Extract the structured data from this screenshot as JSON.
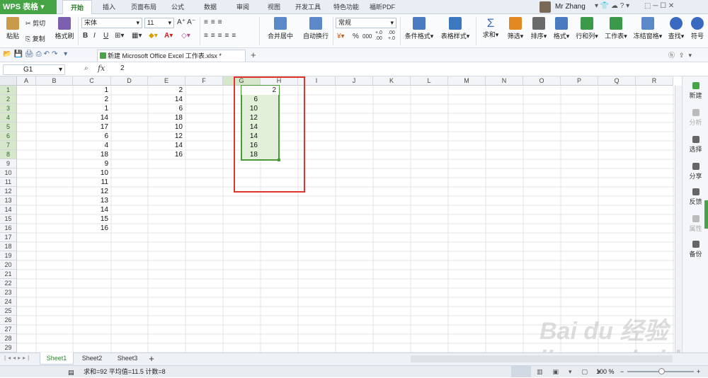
{
  "app": {
    "name": "WPS 表格"
  },
  "menu_tabs": [
    "开始",
    "插入",
    "页面布局",
    "公式",
    "数据",
    "审阅",
    "视图",
    "开发工具",
    "特色功能",
    "福昕PDF"
  ],
  "user": {
    "name": "Mr Zhang"
  },
  "ribbon": {
    "paste": "粘贴",
    "cut": "剪切",
    "copy": "复制",
    "format_painter": "格式刷",
    "font_name": "宋体",
    "font_size": "11",
    "merge_center": "合并居中",
    "wrap_text": "自动换行",
    "number_format": "常规",
    "conditional_format": "条件格式",
    "table_style": "表格样式",
    "sum": "求和",
    "filter": "筛选",
    "sort": "排序",
    "format": "格式",
    "rows_cols": "行和列",
    "worksheet": "工作表",
    "freeze": "冻结窗格",
    "find": "查找",
    "symbol": "符号",
    "percent": "%",
    "comma": "000",
    "dec_inc": "+.0 .00",
    "dec_dec": ".00 +.0"
  },
  "document": {
    "tab_title": "新建 Microsoft Office Excel 工作表.xlsx *"
  },
  "formula_bar": {
    "name_box": "G1",
    "fx": "fx",
    "value": "2"
  },
  "grid": {
    "columns": [
      "A",
      "B",
      "C",
      "D",
      "E",
      "F",
      "G",
      "H",
      "I",
      "J",
      "K",
      "L",
      "M",
      "N",
      "O",
      "P",
      "Q",
      "R"
    ],
    "rows": [
      "1",
      "2",
      "3",
      "4",
      "5",
      "6",
      "7",
      "8",
      "9",
      "10",
      "11",
      "12",
      "13",
      "14",
      "15",
      "16",
      "17",
      "18",
      "19",
      "20",
      "21",
      "22",
      "23",
      "24",
      "25",
      "26",
      "27",
      "28",
      "29"
    ],
    "col_c": [
      "1",
      "2",
      "1",
      "14",
      "17",
      "6",
      "4",
      "18",
      "9",
      "10",
      "11",
      "12",
      "13",
      "14",
      "15",
      "16"
    ],
    "col_e": [
      "2",
      "14",
      "6",
      "18",
      "10",
      "12",
      "14",
      "16"
    ],
    "col_g": [
      "2",
      "6",
      "10",
      "12",
      "14",
      "14",
      "16",
      "18"
    ]
  },
  "side_panel": [
    "新建",
    "分析",
    "选择",
    "分享",
    "反馈",
    "属性",
    "备份"
  ],
  "sheets": [
    "Sheet1",
    "Sheet2",
    "Sheet3"
  ],
  "status_bar": {
    "summary": "求和=92  平均值=11.5  计数=8",
    "zoom": "100 %"
  },
  "colors": {
    "brand": "#46a446",
    "selection": "#e2f0d9",
    "selection_border": "#4a9a3a",
    "highlight_box": "#e0342c"
  },
  "watermark": "Bai du 经验 jingyan.baidu.com"
}
